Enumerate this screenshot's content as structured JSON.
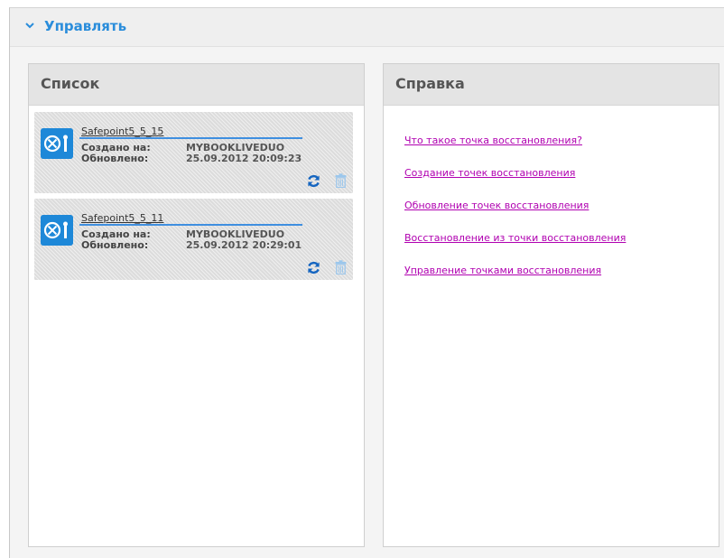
{
  "section": {
    "title": "Управлять",
    "chevron_icon": "chevron-down-icon",
    "accent_color": "#2a8ddb"
  },
  "list_panel": {
    "title": "Список",
    "items": [
      {
        "name": "Safepoint5_5_15",
        "created_label": "Создано на:",
        "created_value": "MYBOOKLIVEDUO",
        "updated_label": "Обновлено:",
        "updated_value": "25.09.2012 20:09:23",
        "icon": "safepoint-icon",
        "actions": [
          "refresh-icon",
          "trash-icon"
        ]
      },
      {
        "name": "Safepoint5_5_11",
        "created_label": "Создано на:",
        "created_value": "MYBOOKLIVEDUO",
        "updated_label": "Обновлено:",
        "updated_value": "25.09.2012 20:29:01",
        "icon": "safepoint-icon",
        "actions": [
          "refresh-icon",
          "trash-icon"
        ]
      }
    ]
  },
  "help_panel": {
    "title": "Справка",
    "link_color": "#b000b0",
    "links": [
      "Что такое точка восстановления?",
      "Создание точек восстановления",
      "Обновление точек восстановления",
      "Восстановление из точки восстановления",
      "Управление точками восстановления"
    ]
  }
}
